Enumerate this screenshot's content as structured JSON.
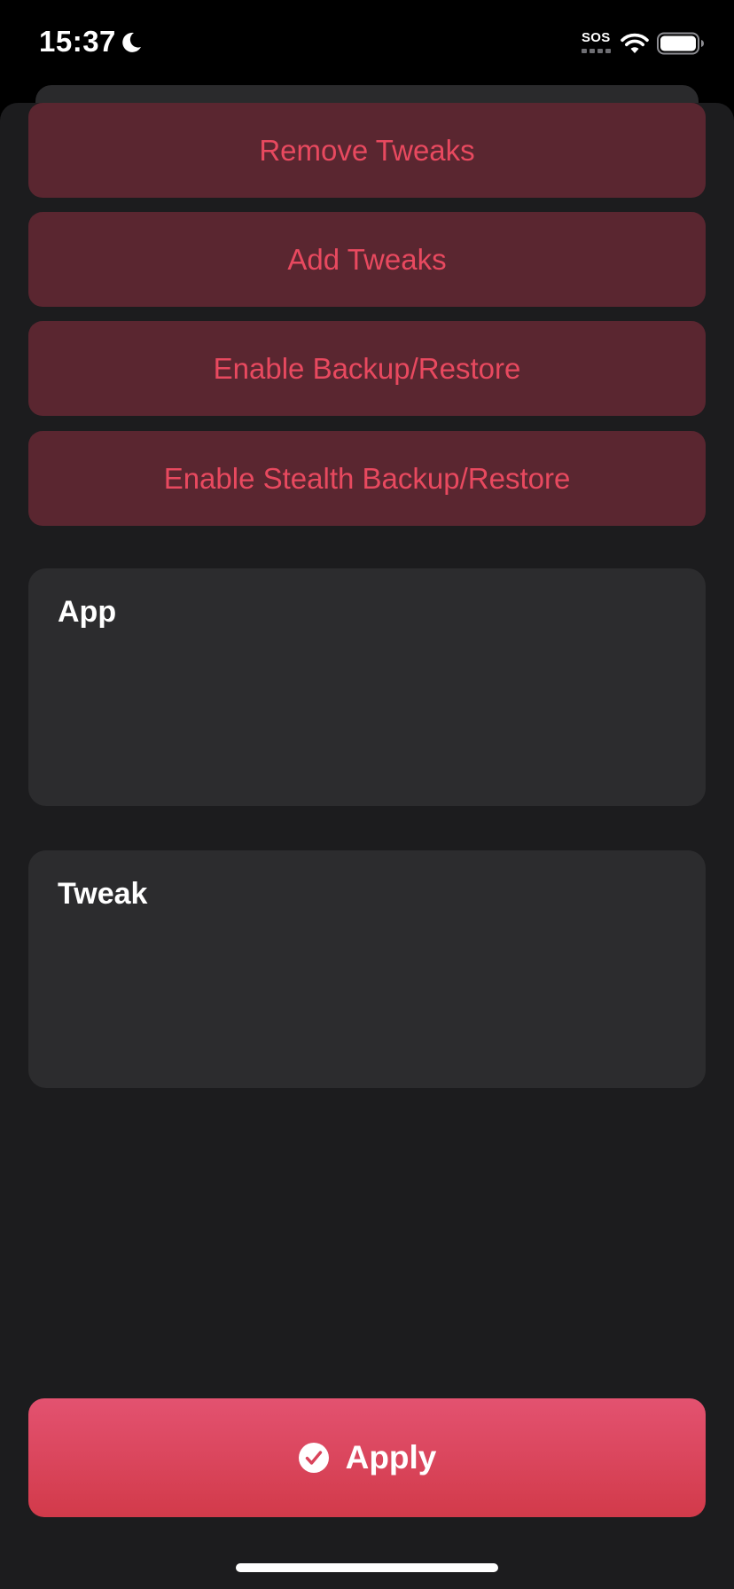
{
  "status_bar": {
    "time": "15:37",
    "sos": "SOS",
    "icons": [
      "moon-icon",
      "wifi-icon",
      "battery-icon"
    ]
  },
  "actions": [
    {
      "label": "Remove Tweaks"
    },
    {
      "label": "Add Tweaks"
    },
    {
      "label": "Enable Backup/Restore"
    },
    {
      "label": "Enable Stealth Backup/Restore"
    }
  ],
  "pickers": {
    "app": {
      "label": "App"
    },
    "tweak": {
      "label": "Tweak"
    }
  },
  "apply": {
    "label": "Apply",
    "icon": "checkmark-circle-icon"
  },
  "colors": {
    "action_background": "#5a2630",
    "action_text": "#e8495f",
    "card_background": "#2c2c2e",
    "sheet_background": "#1c1c1e",
    "apply_gradient_top": "#e35270",
    "apply_gradient_bottom": "#d23a4a"
  }
}
